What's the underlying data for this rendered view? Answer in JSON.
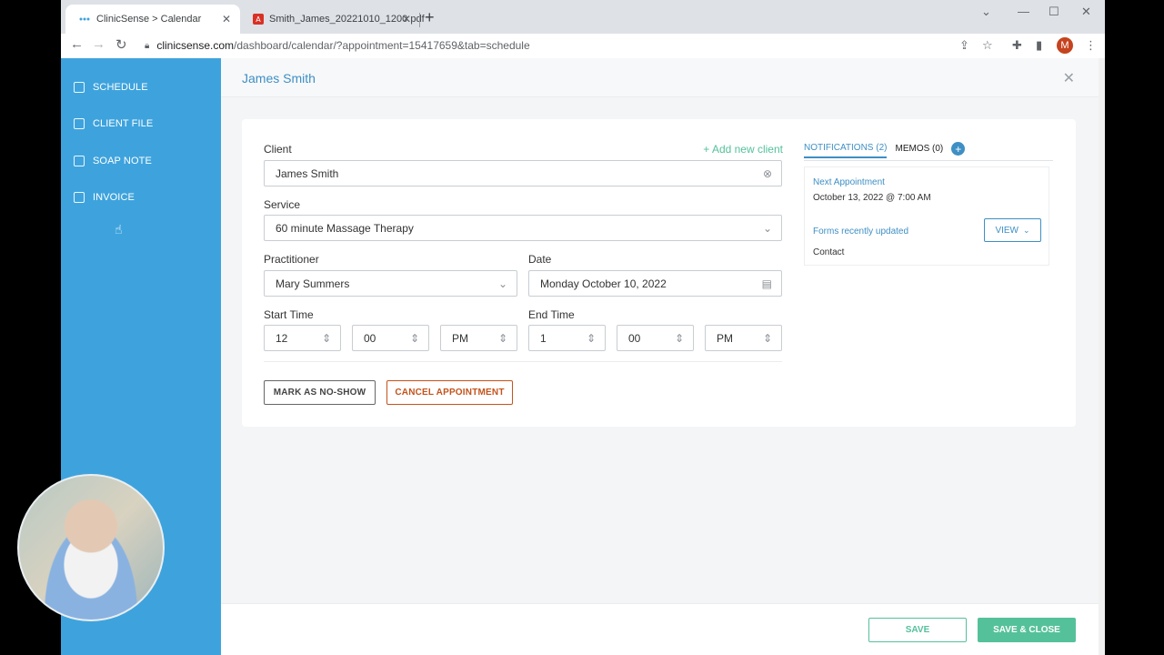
{
  "browser": {
    "tabs": [
      {
        "title": "ClinicSense > Calendar",
        "active": true
      },
      {
        "title": "Smith_James_20221010_1200.pdf",
        "active": false
      }
    ],
    "url_domain": "clinicsense.com",
    "url_path": "/dashboard/calendar/?appointment=15417659&tab=schedule",
    "profile_initial": "M"
  },
  "sidebar": {
    "items": [
      {
        "label": "SCHEDULE",
        "icon": "calendar-icon"
      },
      {
        "label": "CLIENT FILE",
        "icon": "file-icon"
      },
      {
        "label": "SOAP NOTE",
        "icon": "note-icon"
      },
      {
        "label": "INVOICE",
        "icon": "invoice-icon"
      }
    ]
  },
  "header": {
    "title": "James Smith"
  },
  "form": {
    "client_label": "Client",
    "client_value": "James Smith",
    "add_client": "+ Add new client",
    "service_label": "Service",
    "service_value": "60 minute Massage Therapy",
    "practitioner_label": "Practitioner",
    "practitioner_value": "Mary Summers",
    "date_label": "Date",
    "date_value": "Monday October 10, 2022",
    "start_label": "Start Time",
    "start_hour": "12",
    "start_min": "00",
    "start_ampm": "PM",
    "end_label": "End Time",
    "end_hour": "1",
    "end_min": "00",
    "end_ampm": "PM",
    "noshow": "MARK AS NO-SHOW",
    "cancel": "CANCEL APPOINTMENT"
  },
  "right": {
    "tab_notifications": "NOTIFICATIONS (2)",
    "tab_memos": "MEMOS (0)",
    "next_title": "Next Appointment",
    "next_value": "October 13, 2022 @ 7:00 AM",
    "forms_title": "Forms recently updated",
    "forms_value": "Contact",
    "view": "VIEW"
  },
  "footer": {
    "save": "SAVE",
    "save_close": "SAVE & CLOSE"
  },
  "colors": {
    "sidebar": "#3ea3dd",
    "accent": "#3e8fc4",
    "green": "#55c19a",
    "cancel": "#c4531c"
  }
}
